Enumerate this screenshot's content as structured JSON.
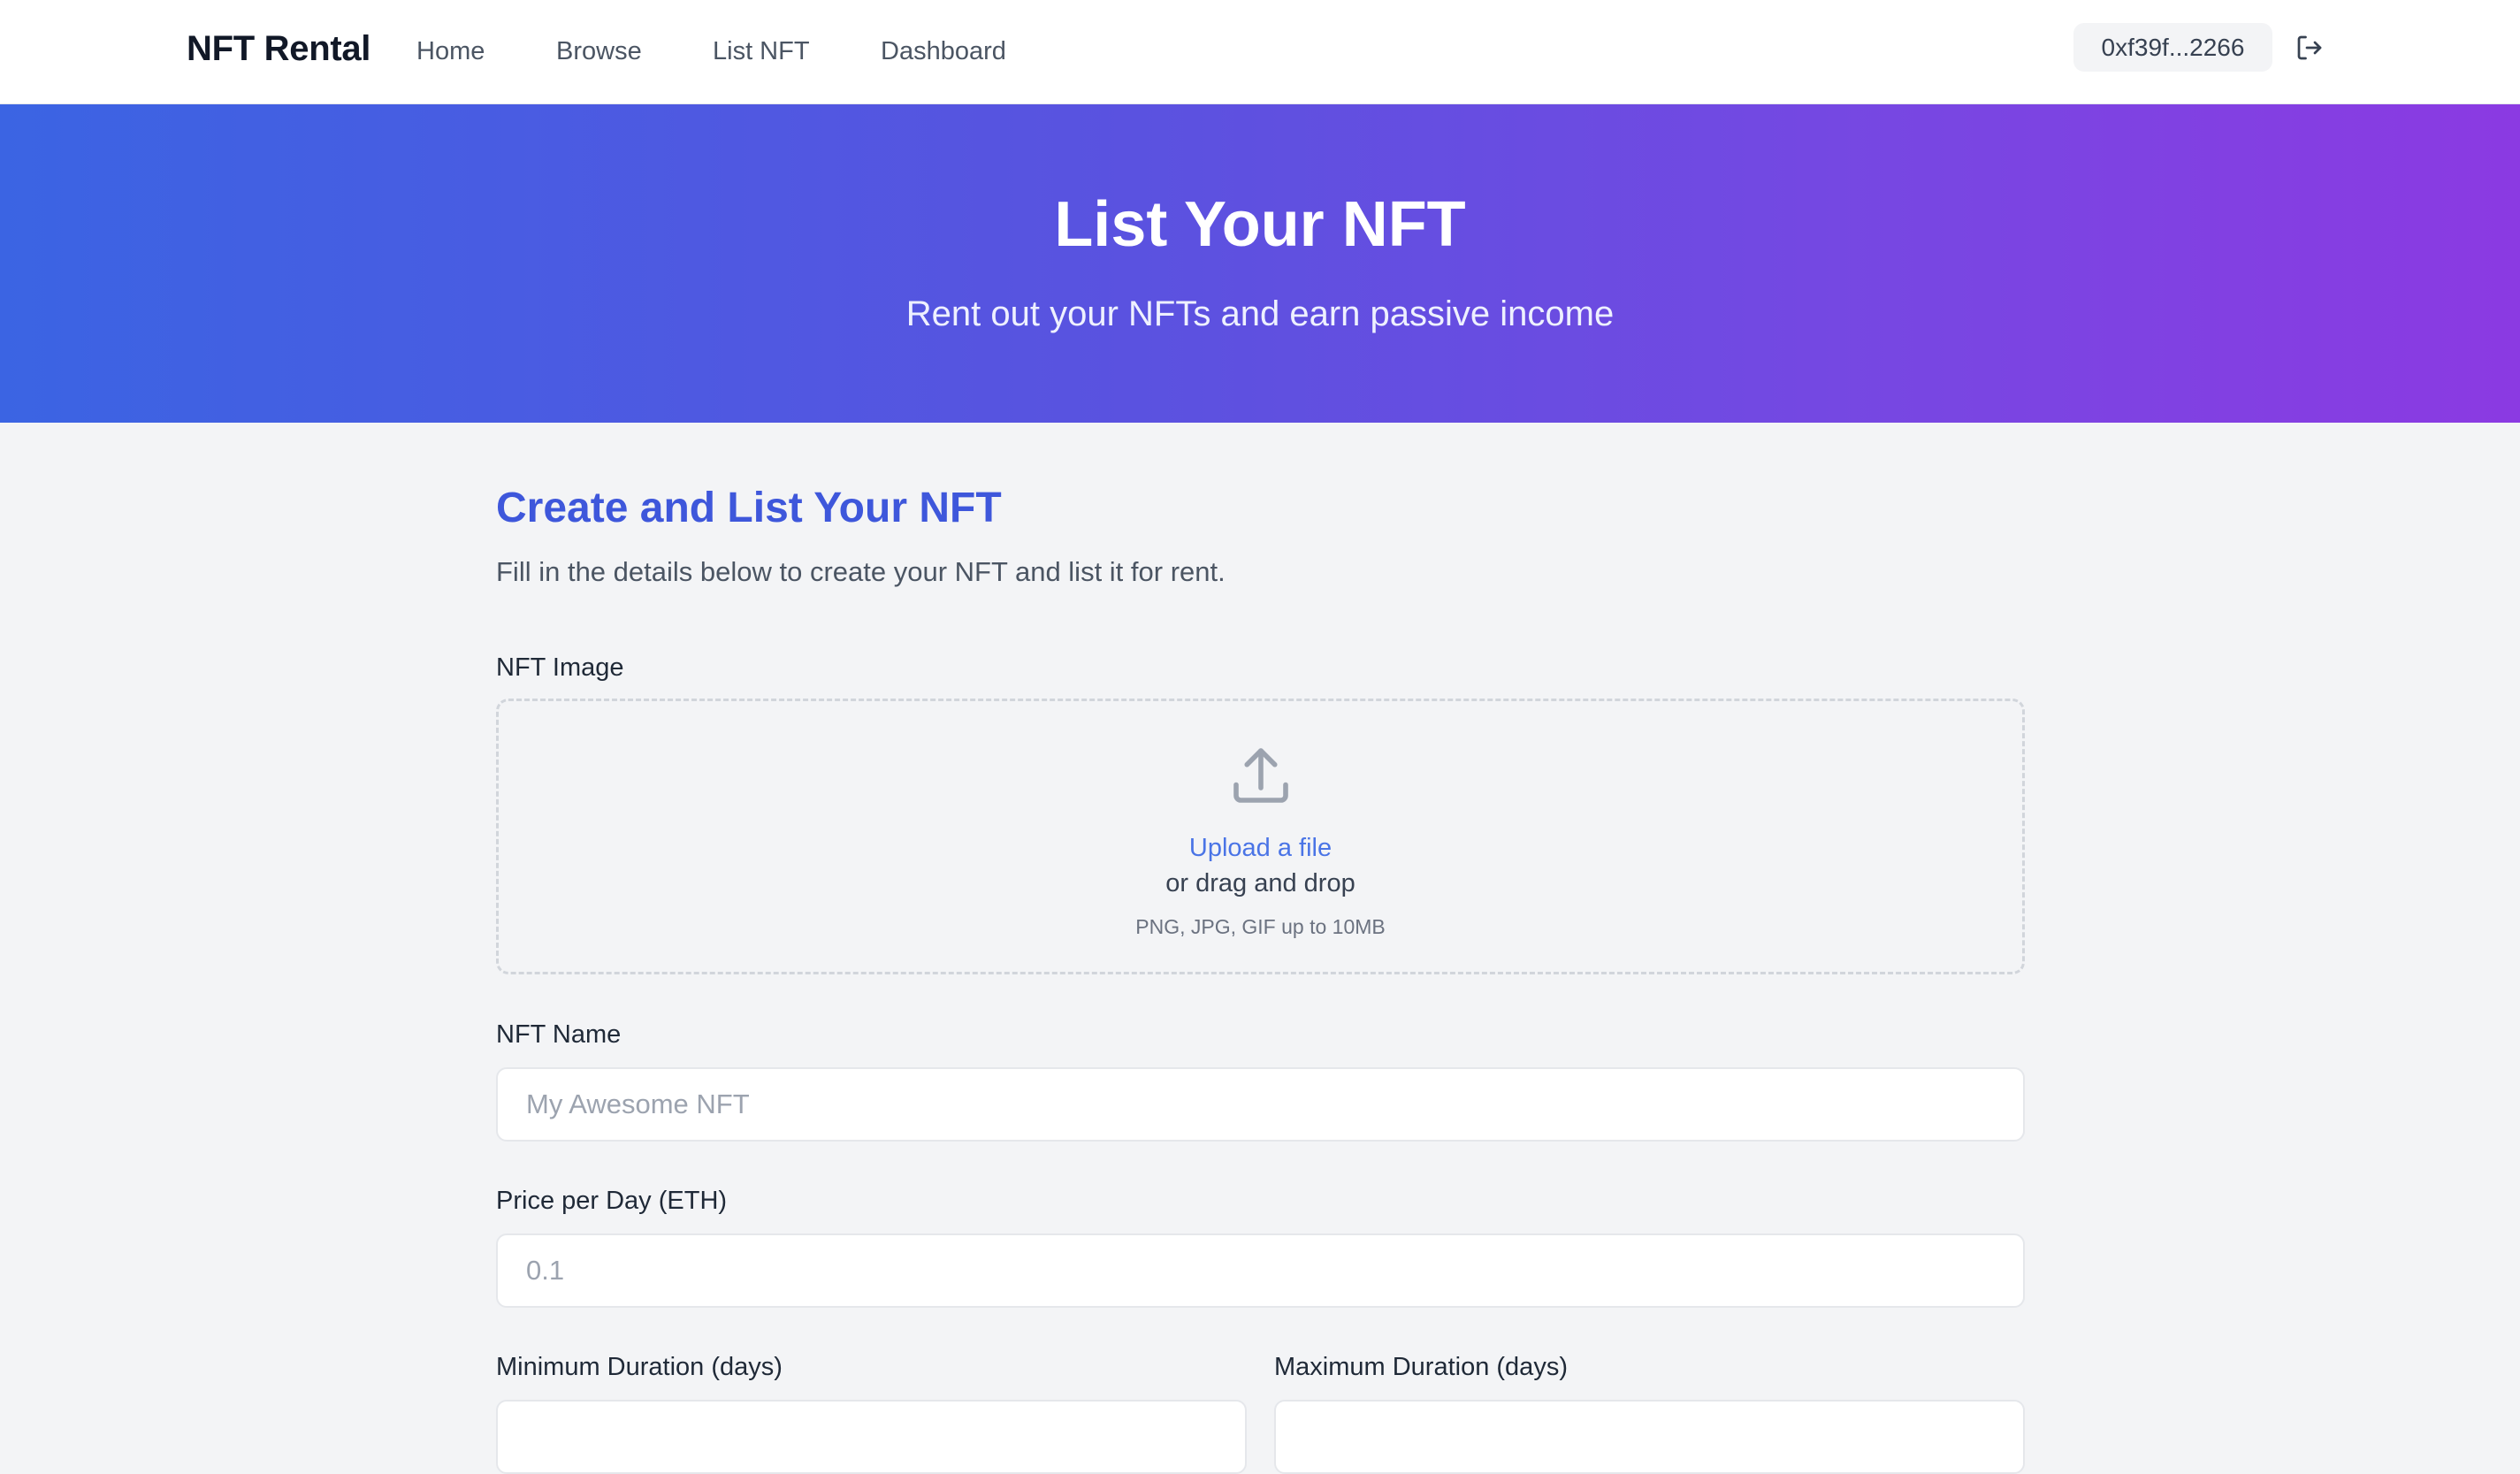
{
  "nav": {
    "brand": "NFT Rental",
    "links": [
      "Home",
      "Browse",
      "List NFT",
      "Dashboard"
    ],
    "wallet_address": "0xf39f...2266",
    "logout_icon": "logout-icon"
  },
  "hero": {
    "title": "List Your NFT",
    "subtitle": "Rent out your NFTs and earn passive income"
  },
  "form": {
    "title": "Create and List Your NFT",
    "description": "Fill in the details below to create your NFT and list it for rent.",
    "image": {
      "label": "NFT Image",
      "icon": "upload-icon",
      "upload_link": "Upload a file",
      "drag_text": "or drag and drop",
      "hint": "PNG, JPG, GIF up to 10MB"
    },
    "name": {
      "label": "NFT Name",
      "placeholder": "My Awesome NFT",
      "value": ""
    },
    "price": {
      "label": "Price per Day (ETH)",
      "placeholder": "0.1",
      "value": ""
    },
    "min_duration": {
      "label": "Minimum Duration (days)",
      "value": ""
    },
    "max_duration": {
      "label": "Maximum Duration (days)",
      "value": ""
    }
  },
  "colors": {
    "accent": "#3e57db",
    "link": "#4a74e6",
    "hero_gradient_start": "#3b64e3",
    "hero_gradient_end": "#8b3ae2",
    "page_background": "#f3f4f6"
  }
}
